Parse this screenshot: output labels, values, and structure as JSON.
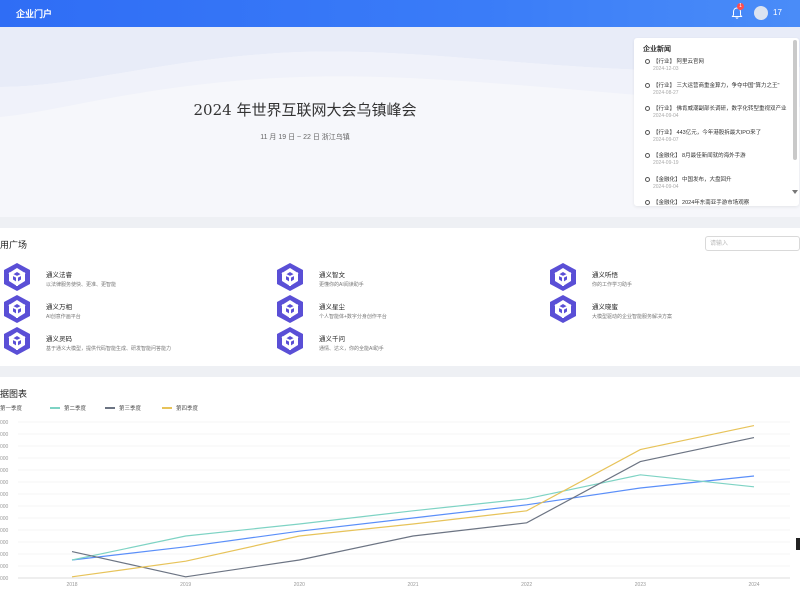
{
  "header": {
    "brand": "企业门户",
    "notification_count": "1",
    "username": "17"
  },
  "banner": {
    "title": "2024 年世界互联网大会乌镇峰会",
    "subtitle": "11 月 19 日 ~ 22 日 浙江乌镇"
  },
  "news": {
    "title": "企业新闻",
    "items": [
      {
        "text": "【行业】 阿里云官网",
        "date": "2024-12-03"
      },
      {
        "text": "【行业】 三大运营商重金算力，争夺中国\"算力之王\"",
        "date": "2024-08-27"
      },
      {
        "text": "【行业】 佛肯威潮副部长调研，数字化转型重视双产业",
        "date": "2024-09-04"
      },
      {
        "text": "【行业】 443亿元，今年港股拆最大IPO来了",
        "date": "2024-09-07"
      },
      {
        "text": "【金融化】 8月最佳新闻就的海外手游",
        "date": "2024-09-19"
      },
      {
        "text": "【金融化】 中国发布，大盘回升",
        "date": "2024-09-04"
      },
      {
        "text": "【金融化】 2024年东南亚手游市场观察",
        "date": "2024-09-01"
      }
    ]
  },
  "apps": {
    "title": "用广场",
    "search_placeholder": "请输入",
    "items": [
      {
        "name": "通义法睿",
        "desc": "以法律服务使快、更准、更智能"
      },
      {
        "name": "通义智文",
        "desc": "更懂你的AI阅读助手"
      },
      {
        "name": "通义听悟",
        "desc": "你的工作学习助手"
      },
      {
        "name": "通义万相",
        "desc": "AI创意作画平台"
      },
      {
        "name": "通义星尘",
        "desc": "个人智能体+数字分身创作平台"
      },
      {
        "name": "通义晓蜜",
        "desc": "大模型驱动的企业智能服务解决方案"
      },
      {
        "name": "通义灵码",
        "desc": "基于通义大模型，提供代码智能生成、研发智能问答能力"
      },
      {
        "name": "通义千问",
        "desc": "通情、达义，你的全能AI助手"
      }
    ]
  },
  "chart_section": {
    "title": "据图表"
  },
  "chart_data": {
    "type": "line",
    "title": "",
    "xlabel": "",
    "ylabel": "",
    "x": [
      "2018",
      "2019",
      "2020",
      "2021",
      "2022",
      "2023",
      "2024"
    ],
    "y_ticks": [
      "000",
      "000",
      "000",
      "000",
      "000",
      "000",
      "000",
      "000",
      "000",
      "000",
      "000",
      "000",
      "000",
      "000"
    ],
    "ylim": [
      0,
      13
    ],
    "series": [
      {
        "name": "第一季度",
        "color": "#5b8ff9",
        "values": [
          1.5,
          2.6,
          3.9,
          5.0,
          6.1,
          7.5,
          8.5
        ]
      },
      {
        "name": "第二季度",
        "color": "#7ed3c4",
        "values": [
          1.5,
          3.5,
          4.5,
          5.6,
          6.6,
          8.6,
          7.6
        ]
      },
      {
        "name": "第三季度",
        "color": "#6c7483",
        "values": [
          2.2,
          0.1,
          1.5,
          3.5,
          4.6,
          9.7,
          11.7
        ]
      },
      {
        "name": "第四季度",
        "color": "#e7c35a",
        "values": [
          0.1,
          1.4,
          3.5,
          4.5,
          5.6,
          10.7,
          12.7
        ]
      }
    ]
  }
}
